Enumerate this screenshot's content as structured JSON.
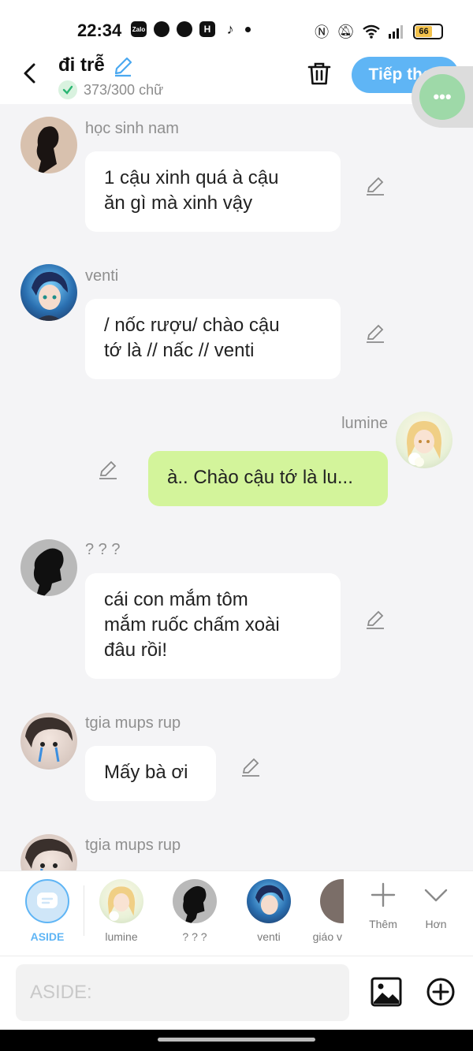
{
  "status_bar": {
    "time": "22:34",
    "apps": [
      "Zalo",
      "",
      "",
      "H",
      "",
      ""
    ],
    "battery": "66"
  },
  "header": {
    "title": "đi trễ",
    "word_count": "373/300 chữ",
    "next_button": "Tiếp theo"
  },
  "messages": [
    {
      "sender": "học sinh nam",
      "text": "1 cậu xinh quá à cậu\năn gì mà xinh vậy",
      "side": "left"
    },
    {
      "sender": "venti",
      "text": "/ nốc rượu/ chào cậu\ntớ là // nấc // venti",
      "side": "left"
    },
    {
      "sender": "lumine",
      "text": "à.. Chào cậu tớ là lu...",
      "side": "right"
    },
    {
      "sender": "? ? ?",
      "text": "cái con mắm tôm\nmắm ruốc chấm xoài\nđâu rồi!",
      "side": "left"
    },
    {
      "sender": "tgia mups rup",
      "text": "Mấy bà ơi",
      "side": "left"
    },
    {
      "sender": "tgia mups rup",
      "text": "",
      "side": "left"
    }
  ],
  "characters": [
    {
      "label": "ASIDE"
    },
    {
      "label": "lumine"
    },
    {
      "label": "? ? ?"
    },
    {
      "label": "venti"
    },
    {
      "label": "giáo v"
    }
  ],
  "tools": {
    "add_label": "Thêm",
    "more_label": "Hơn"
  },
  "input": {
    "placeholder": "ASIDE:"
  },
  "colors": {
    "accent": "#5fb5f5",
    "my_bubble": "#d3f49b",
    "background": "#f4f4f6"
  }
}
